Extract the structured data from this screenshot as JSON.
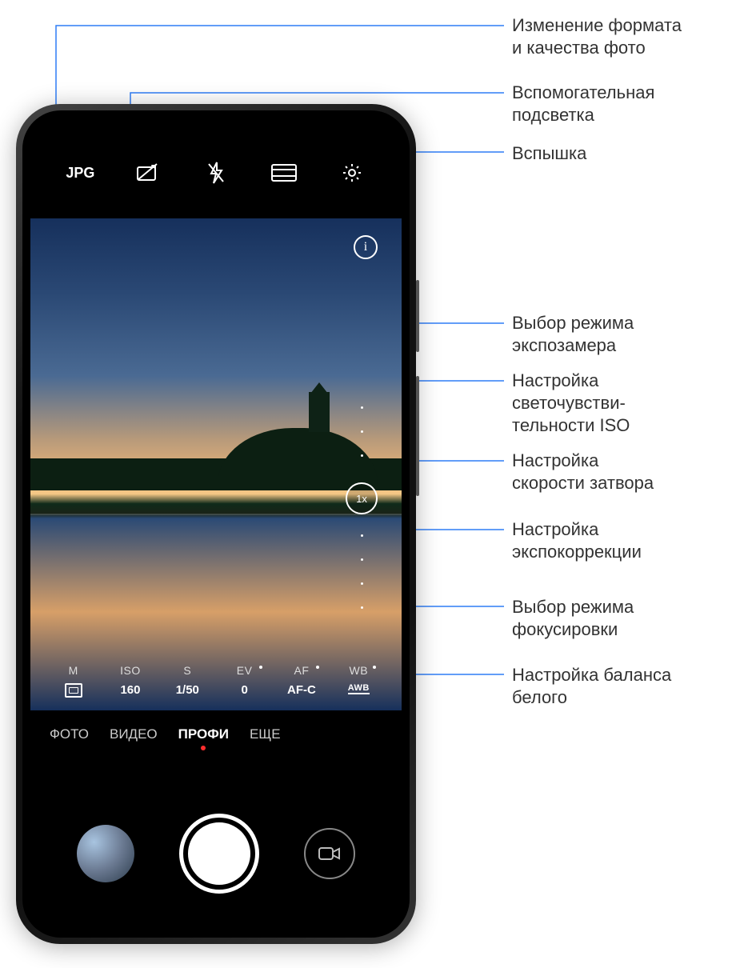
{
  "callouts": {
    "format": "Изменение формата\nи качества фото",
    "light": "Вспомогательная\nподсветка",
    "flash": "Вспышка",
    "metering": "Выбор режима\nэкспозамера",
    "iso": "Настройка\nсветочувстви-\nтельности ISO",
    "shutter": "Настройка\nскорости затвора",
    "ev": "Настройка\nэкспокоррекции",
    "af": "Выбор режима\nфокусировки",
    "wb": "Настройка баланса\nбелого"
  },
  "topbar": {
    "jpg": "JPG"
  },
  "info_icon": "i",
  "zoom": "1x",
  "params": {
    "m": {
      "label": "M",
      "value_icon": "meter"
    },
    "iso": {
      "label": "ISO",
      "value": "160"
    },
    "s": {
      "label": "S",
      "value": "1/50"
    },
    "ev": {
      "label": "EV",
      "value": "0"
    },
    "af": {
      "label": "AF",
      "value": "AF-C"
    },
    "wb": {
      "label": "WB",
      "value_icon": "awb",
      "value_text": "AWB"
    }
  },
  "modes": {
    "photo": "ФОТО",
    "video": "ВИДЕО",
    "pro": "ПРОФИ",
    "more": "ЕЩЕ"
  }
}
